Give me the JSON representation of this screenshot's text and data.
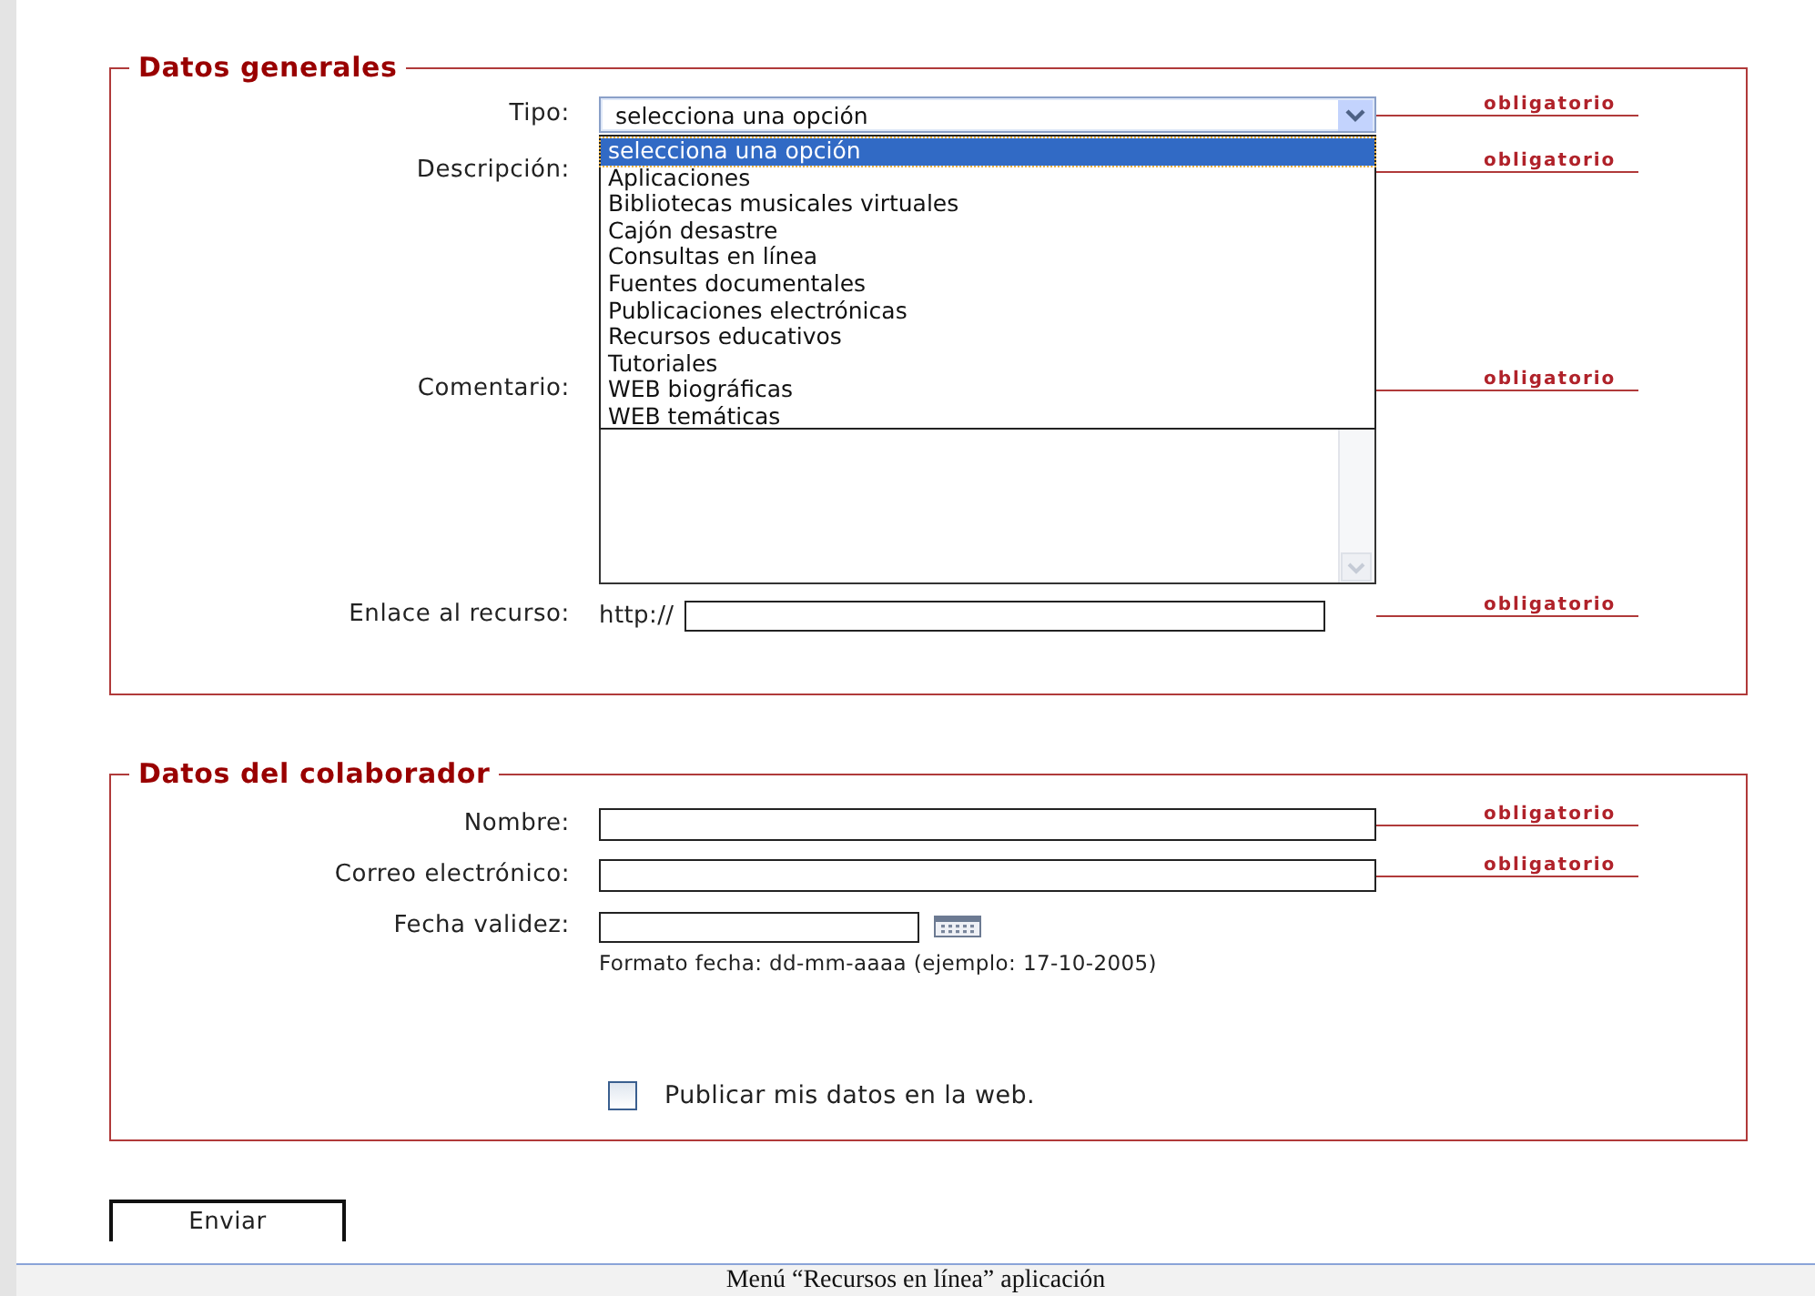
{
  "sections": [
    {
      "legend": "Datos generales",
      "fields": [
        {
          "kind": "select",
          "label": "Tipo:",
          "value": "selecciona una opción",
          "required": "obligatorio",
          "expanded": true,
          "options": [
            {
              "label": "selecciona una opción",
              "selected": true
            },
            {
              "label": "Aplicaciones",
              "selected": false
            },
            {
              "label": "Bibliotecas musicales virtuales",
              "selected": false
            },
            {
              "label": "Cajón desastre",
              "selected": false
            },
            {
              "label": "Consultas en línea",
              "selected": false
            },
            {
              "label": "Fuentes documentales",
              "selected": false
            },
            {
              "label": "Publicaciones electrónicas",
              "selected": false
            },
            {
              "label": "Recursos educativos",
              "selected": false
            },
            {
              "label": "Tutoriales",
              "selected": false
            },
            {
              "label": "WEB biográficas",
              "selected": false
            },
            {
              "label": "WEB temáticas",
              "selected": false
            }
          ]
        },
        {
          "kind": "covered",
          "label": "Descripción:",
          "required": "obligatorio"
        },
        {
          "kind": "textarea",
          "label": "Comentario:",
          "required": "obligatorio"
        },
        {
          "kind": "url",
          "label": "Enlace al recurso:",
          "prefix": "http://",
          "required": "obligatorio"
        }
      ]
    },
    {
      "legend": "Datos del colaborador",
      "fields": [
        {
          "kind": "text",
          "label": "Nombre:",
          "required": "obligatorio"
        },
        {
          "kind": "text",
          "label": "Correo electrónico:",
          "required": "obligatorio"
        },
        {
          "kind": "date",
          "label": "Fecha validez:",
          "hint": "Formato fecha: dd-mm-aaaa (ejemplo: 17-10-2005)"
        },
        {
          "kind": "checkbox",
          "label": "Publicar mis datos en la web.",
          "checked": false
        }
      ]
    }
  ],
  "submit": "Enviar",
  "caption": "Menú “Recursos en línea” aplicación"
}
